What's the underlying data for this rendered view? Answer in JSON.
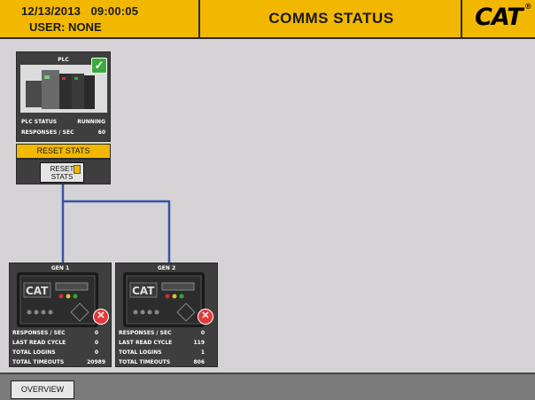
{
  "header": {
    "datetime": "12/13/2013   09:00:05",
    "user": "USER: NONE",
    "title": "COMMS STATUS",
    "logo": "CAT",
    "logo_mark": "®"
  },
  "plc": {
    "title": "PLC",
    "status_icon": "checkmark-icon",
    "stats": [
      {
        "label": "PLC STATUS",
        "value": "RUNNING"
      },
      {
        "label": "RESPONSES / SEC",
        "value": "60"
      }
    ]
  },
  "reset": {
    "bar_label": "RESET STATS",
    "button_label_1": "RESET",
    "button_label_2": "STATS"
  },
  "generators": [
    {
      "title": "GEN 1",
      "status_icon": "error-x-icon",
      "stats": [
        {
          "label": "RESPONSES / SEC",
          "value": "0"
        },
        {
          "label": "LAST READ CYCLE",
          "value": "0"
        },
        {
          "label": "TOTAL LOGINS",
          "value": "0"
        },
        {
          "label": "TOTAL TIMEOUTS",
          "value": "20989"
        }
      ]
    },
    {
      "title": "GEN 2",
      "status_icon": "error-x-icon",
      "stats": [
        {
          "label": "RESPONSES / SEC",
          "value": "0"
        },
        {
          "label": "LAST READ CYCLE",
          "value": "119"
        },
        {
          "label": "TOTAL LOGINS",
          "value": "1"
        },
        {
          "label": "TOTAL TIMEOUTS",
          "value": "806"
        }
      ]
    }
  ],
  "footer": {
    "overview_label": "OVERVIEW"
  },
  "colors": {
    "header": "#f2b800",
    "panel": "#3e3e3e",
    "connection_line": "#3355aa",
    "ok": "#3caa3c",
    "error": "#e23a3a"
  }
}
